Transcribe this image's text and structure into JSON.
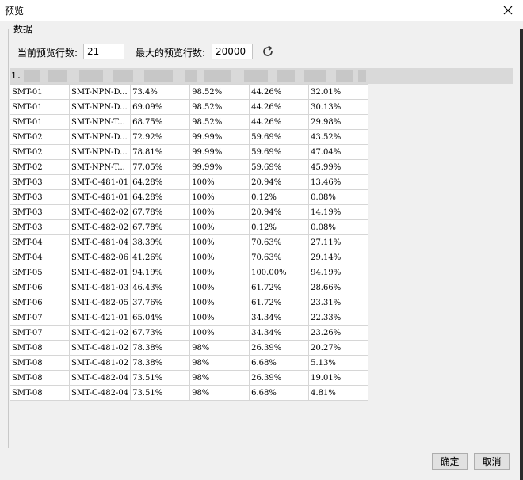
{
  "window": {
    "title": "预览"
  },
  "group": {
    "legend": "数据"
  },
  "controls": {
    "current_rows_label": "当前预览行数:",
    "current_rows_value": "21",
    "max_rows_label": "最大的预览行数:",
    "max_rows_value": "20000"
  },
  "grid": {
    "header_index": "1.",
    "rows": [
      [
        "SMT-01",
        "SMT-NPN-D...",
        "73.4%",
        "98.52%",
        "44.26%",
        "32.01%"
      ],
      [
        "SMT-01",
        "SMT-NPN-D...",
        "69.09%",
        "98.52%",
        "44.26%",
        "30.13%"
      ],
      [
        "SMT-01",
        "SMT-NPN-T...",
        "68.75%",
        "98.52%",
        "44.26%",
        "29.98%"
      ],
      [
        "SMT-02",
        "SMT-NPN-D...",
        "72.92%",
        "99.99%",
        "59.69%",
        "43.52%"
      ],
      [
        "SMT-02",
        "SMT-NPN-D...",
        "78.81%",
        "99.99%",
        "59.69%",
        "47.04%"
      ],
      [
        "SMT-02",
        "SMT-NPN-T...",
        "77.05%",
        "99.99%",
        "59.69%",
        "45.99%"
      ],
      [
        "SMT-03",
        "SMT-C-481-01",
        "64.28%",
        "100%",
        "20.94%",
        "13.46%"
      ],
      [
        "SMT-03",
        "SMT-C-481-01",
        "64.28%",
        "100%",
        "0.12%",
        "0.08%"
      ],
      [
        "SMT-03",
        "SMT-C-482-02",
        "67.78%",
        "100%",
        "20.94%",
        "14.19%"
      ],
      [
        "SMT-03",
        "SMT-C-482-02",
        "67.78%",
        "100%",
        "0.12%",
        "0.08%"
      ],
      [
        "SMT-04",
        "SMT-C-481-04",
        "38.39%",
        "100%",
        "70.63%",
        "27.11%"
      ],
      [
        "SMT-04",
        "SMT-C-482-06",
        "41.26%",
        "100%",
        "70.63%",
        "29.14%"
      ],
      [
        "SMT-05",
        "SMT-C-482-01",
        "94.19%",
        "100%",
        "100.00%",
        "94.19%"
      ],
      [
        "SMT-06",
        "SMT-C-481-03",
        "46.43%",
        "100%",
        "61.72%",
        "28.66%"
      ],
      [
        "SMT-06",
        "SMT-C-482-05",
        "37.76%",
        "100%",
        "61.72%",
        "23.31%"
      ],
      [
        "SMT-07",
        "SMT-C-421-01",
        "65.04%",
        "100%",
        "34.34%",
        "22.33%"
      ],
      [
        "SMT-07",
        "SMT-C-421-02",
        "67.73%",
        "100%",
        "34.34%",
        "23.26%"
      ],
      [
        "SMT-08",
        "SMT-C-481-02",
        "78.38%",
        "98%",
        "26.39%",
        "20.27%"
      ],
      [
        "SMT-08",
        "SMT-C-481-02",
        "78.38%",
        "98%",
        "6.68%",
        "5.13%"
      ],
      [
        "SMT-08",
        "SMT-C-482-04",
        "73.51%",
        "98%",
        "26.39%",
        "19.01%"
      ],
      [
        "SMT-08",
        "SMT-C-482-04",
        "73.51%",
        "98%",
        "6.68%",
        "4.81%"
      ]
    ]
  },
  "footer": {
    "ok_label": "确定",
    "cancel_label": "取消"
  },
  "icons": {
    "close": "close-icon",
    "refresh": "refresh-icon"
  }
}
